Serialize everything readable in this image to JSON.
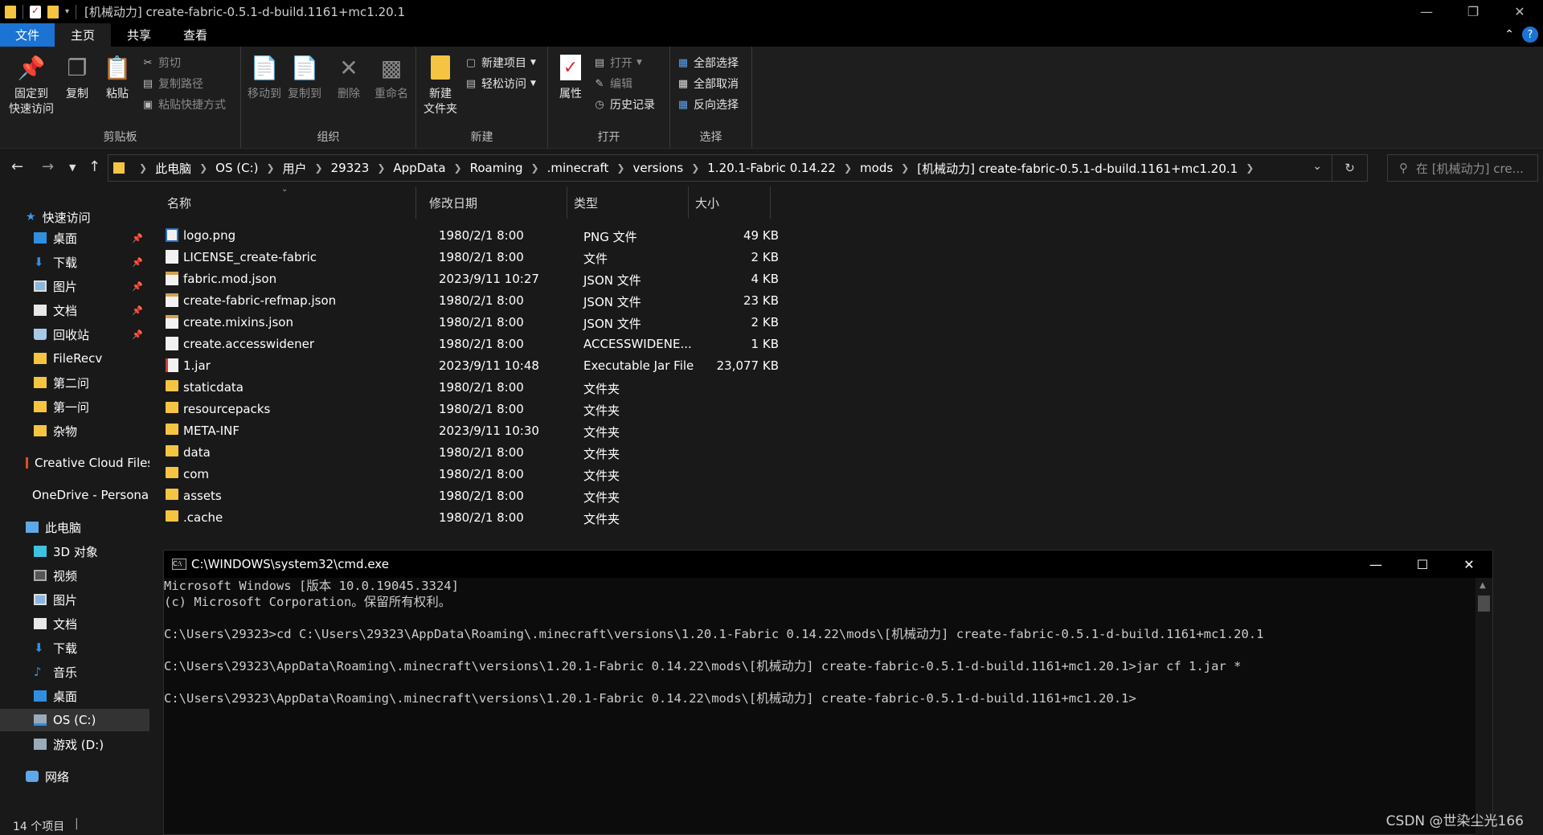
{
  "window": {
    "title": "[机械动力] create-fabric-0.5.1-d-build.1161+mc1.20.1"
  },
  "ribbon_tabs": [
    "文件",
    "主页",
    "共享",
    "查看"
  ],
  "ribbon": {
    "clipboard": {
      "label": "剪贴板",
      "pin_line1": "固定到",
      "pin_line2": "快速访问",
      "copy": "复制",
      "paste": "粘贴",
      "cut": "剪切",
      "copy_path": "复制路径",
      "paste_shortcut": "粘贴快捷方式"
    },
    "organize": {
      "label": "组织",
      "move_to": "移动到",
      "copy_to": "复制到",
      "delete": "删除",
      "rename": "重命名"
    },
    "new": {
      "label": "新建",
      "new_folder_line1": "新建",
      "new_folder_line2": "文件夹",
      "new_item": "新建项目",
      "easy_access": "轻松访问"
    },
    "open": {
      "label": "打开",
      "properties": "属性",
      "open": "打开",
      "edit": "编辑",
      "history": "历史记录"
    },
    "select": {
      "label": "选择",
      "select_all": "全部选择",
      "select_none": "全部取消",
      "invert": "反向选择"
    }
  },
  "breadcrumbs": [
    "此电脑",
    "OS (C:)",
    "用户",
    "29323",
    "AppData",
    "Roaming",
    ".minecraft",
    "versions",
    "1.20.1-Fabric 0.14.22",
    "mods",
    "[机械动力] create-fabric-0.5.1-d-build.1161+mc1.20.1"
  ],
  "search": {
    "placeholder": "在 [机械动力] cre..."
  },
  "sidebar": {
    "quick_access": "快速访问",
    "items": [
      "桌面",
      "下载",
      "图片",
      "文档",
      "回收站",
      "FileRecv",
      "第二问",
      "第一问",
      "杂物"
    ],
    "creative_cloud": "Creative Cloud Files",
    "onedrive": "OneDrive - Personal",
    "this_pc": "此电脑",
    "pc_items": [
      "3D 对象",
      "视频",
      "图片",
      "文档",
      "下载",
      "音乐",
      "桌面",
      "OS (C:)",
      "游戏 (D:)"
    ],
    "network": "网络"
  },
  "columns": [
    "名称",
    "修改日期",
    "类型",
    "大小"
  ],
  "files": [
    {
      "name": "logo.png",
      "date": "1980/2/1 8:00",
      "type": "PNG 文件",
      "size": "49 KB",
      "icon": "png-icon"
    },
    {
      "name": "LICENSE_create-fabric",
      "date": "1980/2/1 8:00",
      "type": "文件",
      "size": "2 KB",
      "icon": "document-icon"
    },
    {
      "name": "fabric.mod.json",
      "date": "2023/9/11 10:27",
      "type": "JSON 文件",
      "size": "4 KB",
      "icon": "json-icon"
    },
    {
      "name": "create-fabric-refmap.json",
      "date": "1980/2/1 8:00",
      "type": "JSON 文件",
      "size": "23 KB",
      "icon": "json-icon"
    },
    {
      "name": "create.mixins.json",
      "date": "1980/2/1 8:00",
      "type": "JSON 文件",
      "size": "2 KB",
      "icon": "json-icon"
    },
    {
      "name": "create.accesswidener",
      "date": "1980/2/1 8:00",
      "type": "ACCESSWIDENE...",
      "size": "1 KB",
      "icon": "document-icon"
    },
    {
      "name": "1.jar",
      "date": "2023/9/11 10:48",
      "type": "Executable Jar File",
      "size": "23,077 KB",
      "icon": "jar-icon"
    },
    {
      "name": "staticdata",
      "date": "1980/2/1 8:00",
      "type": "文件夹",
      "size": "",
      "icon": "folder-icon"
    },
    {
      "name": "resourcepacks",
      "date": "1980/2/1 8:00",
      "type": "文件夹",
      "size": "",
      "icon": "folder-icon"
    },
    {
      "name": "META-INF",
      "date": "2023/9/11 10:30",
      "type": "文件夹",
      "size": "",
      "icon": "folder-icon"
    },
    {
      "name": "data",
      "date": "1980/2/1 8:00",
      "type": "文件夹",
      "size": "",
      "icon": "folder-icon"
    },
    {
      "name": "com",
      "date": "1980/2/1 8:00",
      "type": "文件夹",
      "size": "",
      "icon": "folder-icon"
    },
    {
      "name": "assets",
      "date": "1980/2/1 8:00",
      "type": "文件夹",
      "size": "",
      "icon": "folder-icon"
    },
    {
      "name": ".cache",
      "date": "1980/2/1 8:00",
      "type": "文件夹",
      "size": "",
      "icon": "folder-icon"
    }
  ],
  "status": {
    "count": "14 个项目"
  },
  "cmd": {
    "title": "C:\\WINDOWS\\system32\\cmd.exe",
    "lines": [
      "Microsoft Windows [版本 10.0.19045.3324]",
      "(c) Microsoft Corporation。保留所有权利。",
      "",
      "C:\\Users\\29323>cd C:\\Users\\29323\\AppData\\Roaming\\.minecraft\\versions\\1.20.1-Fabric 0.14.22\\mods\\[机械动力] create-fabric-0.5.1-d-build.1161+mc1.20.1",
      "",
      "C:\\Users\\29323\\AppData\\Roaming\\.minecraft\\versions\\1.20.1-Fabric 0.14.22\\mods\\[机械动力] create-fabric-0.5.1-d-build.1161+mc1.20.1>jar cf 1.jar *",
      "",
      "C:\\Users\\29323\\AppData\\Roaming\\.minecraft\\versions\\1.20.1-Fabric 0.14.22\\mods\\[机械动力] create-fabric-0.5.1-d-build.1161+mc1.20.1>"
    ]
  },
  "watermark": "CSDN @世染尘光166",
  "colors": {
    "accent": "#1b73d3",
    "folder": "#f5c542",
    "background": "#191919"
  }
}
